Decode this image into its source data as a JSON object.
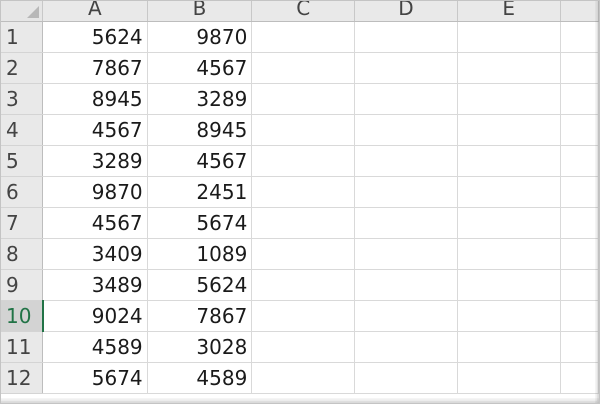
{
  "sheet": {
    "columns": [
      "A",
      "B",
      "C",
      "D",
      "E"
    ],
    "active_row": "10",
    "rows": [
      {
        "num": "1",
        "a": "5624",
        "b": "9870"
      },
      {
        "num": "2",
        "a": "7867",
        "b": "4567"
      },
      {
        "num": "3",
        "a": "8945",
        "b": "3289"
      },
      {
        "num": "4",
        "a": "4567",
        "b": "8945"
      },
      {
        "num": "5",
        "a": "3289",
        "b": "4567"
      },
      {
        "num": "6",
        "a": "9870",
        "b": "2451"
      },
      {
        "num": "7",
        "a": "4567",
        "b": "5674"
      },
      {
        "num": "8",
        "a": "3409",
        "b": "1089"
      },
      {
        "num": "9",
        "a": "3489",
        "b": "5624"
      },
      {
        "num": "10",
        "a": "9024",
        "b": "7867"
      },
      {
        "num": "11",
        "a": "4589",
        "b": "3028"
      },
      {
        "num": "12",
        "a": "5674",
        "b": "4589"
      }
    ]
  },
  "colors": {
    "accent": "#217346",
    "header_bg": "#e9e9e9",
    "gridline": "#d9d9d9"
  }
}
